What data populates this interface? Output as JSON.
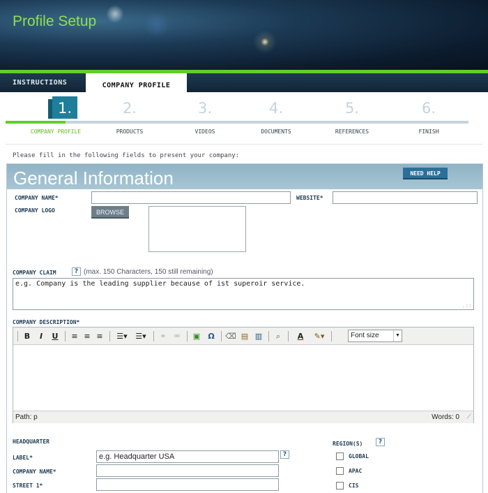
{
  "header": {
    "title": "Profile Setup"
  },
  "tabs": [
    {
      "label": "INSTRUCTIONS",
      "active": false
    },
    {
      "label": "COMPANY PROFILE",
      "active": true
    }
  ],
  "steps": [
    {
      "number": "1.",
      "label": "COMPANY PROFILE",
      "active": true
    },
    {
      "number": "2.",
      "label": "PRODUCTS",
      "active": false
    },
    {
      "number": "3.",
      "label": "VIDEOS",
      "active": false
    },
    {
      "number": "4.",
      "label": "DOCUMENTS",
      "active": false
    },
    {
      "number": "5.",
      "label": "REFERENCES",
      "active": false
    },
    {
      "number": "6.",
      "label": "FINISH",
      "active": false
    }
  ],
  "intro_text": "Please fill in the following fields to present your company:",
  "panel": {
    "title": "General Information",
    "help_label": "NEED HELP"
  },
  "form": {
    "company_name_label": "COMPANY NAME*",
    "company_name_value": "",
    "website_label": "WEBSITE*",
    "website_value": "",
    "company_logo_label": "COMPANY LOGO",
    "browse_label": "BROWSE",
    "company_claim_label": "COMPANY CLAIM",
    "help_mark": "?",
    "company_claim_hint": "(max. 150 Characters, 150 still remaining)",
    "company_claim_value": "e.g. Company is the leading supplier because of ist superoir service.",
    "company_description_label": "COMPANY DESCRIPTION*"
  },
  "editor": {
    "toolbar": {
      "bold": "B",
      "italic": "I",
      "underline": "U",
      "omega": "Ω",
      "font_color": "A",
      "font_size_placeholder": "Font size"
    },
    "status_path": "Path: p",
    "status_words": "Words: 0"
  },
  "headquarter": {
    "section_label": "HEADQUARTER",
    "label_label": "LABEL*",
    "label_value": "e.g. Headquarter USA",
    "company_name_label": "COMPANY NAME*",
    "company_name_value": "",
    "street_label": "STREET 1*",
    "street_value": ""
  },
  "regions": {
    "section_label": "REGION(S)",
    "items": [
      {
        "label": "GLOBAL",
        "checked": false
      },
      {
        "label": "APAC",
        "checked": false
      },
      {
        "label": "CIS",
        "checked": false
      }
    ]
  },
  "colors": {
    "accent_green": "#64cc2c",
    "header_dark": "#0c1c2e",
    "active_step": "#1f7f9a",
    "panel_header": "#9bbccb",
    "help_button": "#2c6f98"
  }
}
